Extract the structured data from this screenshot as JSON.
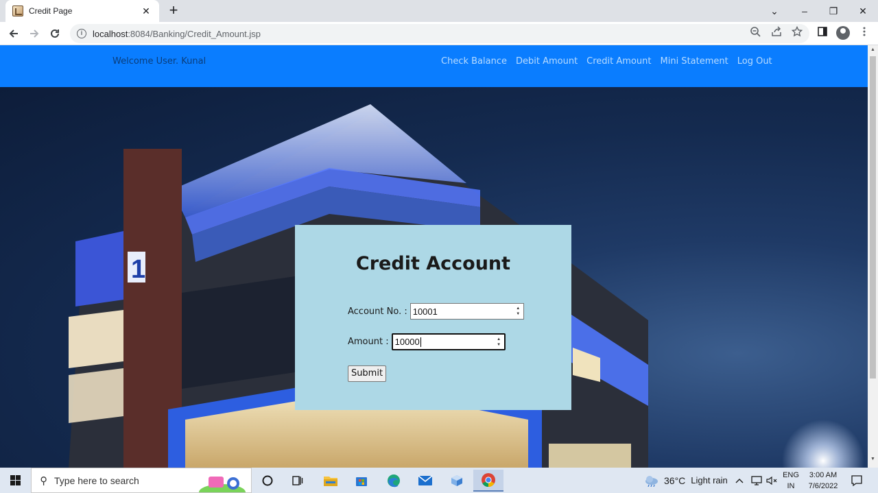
{
  "browser": {
    "tab_title": "Credit Page",
    "tab_close": "✕",
    "new_tab": "+",
    "url_host": "localhost",
    "url_rest": ":8084/Banking/Credit_Amount.jsp",
    "window_controls": [
      "⌄",
      "–",
      "❐",
      "✕"
    ]
  },
  "page": {
    "welcome": "Welcome User. Kunal",
    "nav_links": [
      "Check Balance",
      "Debit Amount",
      "Credit Amount",
      "Mini Statement",
      "Log Out"
    ],
    "form": {
      "title": "Credit Account",
      "account_label": "Account No. :",
      "account_value": "10001",
      "amount_label": "Amount :",
      "amount_value": "10000",
      "submit_label": "Submit"
    }
  },
  "taskbar": {
    "search_placeholder": "Type here to search",
    "weather_temp": "36°C",
    "weather_text": "Light rain",
    "lang_line1": "ENG",
    "lang_line2": "IN",
    "time": "3:00 AM",
    "date": "7/6/2022"
  },
  "colors": {
    "nav_bar": "#0a7dff",
    "form_panel": "#add8e6"
  },
  "icons": [
    "back-arrow-icon",
    "forward-arrow-icon",
    "reload-icon",
    "info-icon",
    "zoom-icon",
    "share-icon",
    "star-icon",
    "sidepanel-icon",
    "profile-icon",
    "menu-dots-icon",
    "windows-start-icon",
    "search-icon",
    "cortana-icon",
    "task-view-icon",
    "file-explorer-icon",
    "store-icon",
    "edge-icon",
    "mail-icon",
    "box-icon",
    "chrome-icon",
    "weather-icon",
    "chevron-up-icon",
    "network-icon",
    "volume-mute-icon",
    "notification-icon"
  ]
}
